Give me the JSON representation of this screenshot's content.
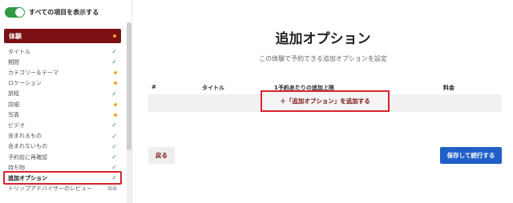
{
  "sidebar": {
    "toggle_label": "すべての項目を表示する",
    "section_title": "体験",
    "items": [
      {
        "label": "タイトル",
        "status": "check"
      },
      {
        "label": "期間",
        "status": "check"
      },
      {
        "label": "カテゴリー＆テーマ",
        "status": "dot"
      },
      {
        "label": "ロケーション",
        "status": "dot"
      },
      {
        "label": "旅程",
        "status": "check"
      },
      {
        "label": "詳細",
        "status": "dot"
      },
      {
        "label": "写真",
        "status": "dot"
      },
      {
        "label": "ビデオ",
        "status": "check"
      },
      {
        "label": "含まれるもの",
        "status": "check"
      },
      {
        "label": "含まれないもの",
        "status": "check"
      },
      {
        "label": "予約前に再確認",
        "status": "check"
      },
      {
        "label": "持ち物",
        "status": "check"
      },
      {
        "label": "追加オプション",
        "status": "check"
      },
      {
        "label": "トリップアドバイザーのレビュー",
        "status": "owl"
      }
    ]
  },
  "main": {
    "title": "追加オプション",
    "subtitle": "この体験で予約できる追加オプションを設定",
    "columns": [
      "#",
      "タイトル",
      "1予約あたりの追加上限",
      "料金"
    ],
    "add_option_label": "＋「追加オプション」を追加する",
    "back_label": "戻る",
    "save_label": "保存して続行する"
  },
  "colors": {
    "brand": "#7b1115",
    "primary": "#1f5fc7",
    "success": "#2e9a47",
    "warning": "#f5a623",
    "highlight": "#d9232d"
  }
}
